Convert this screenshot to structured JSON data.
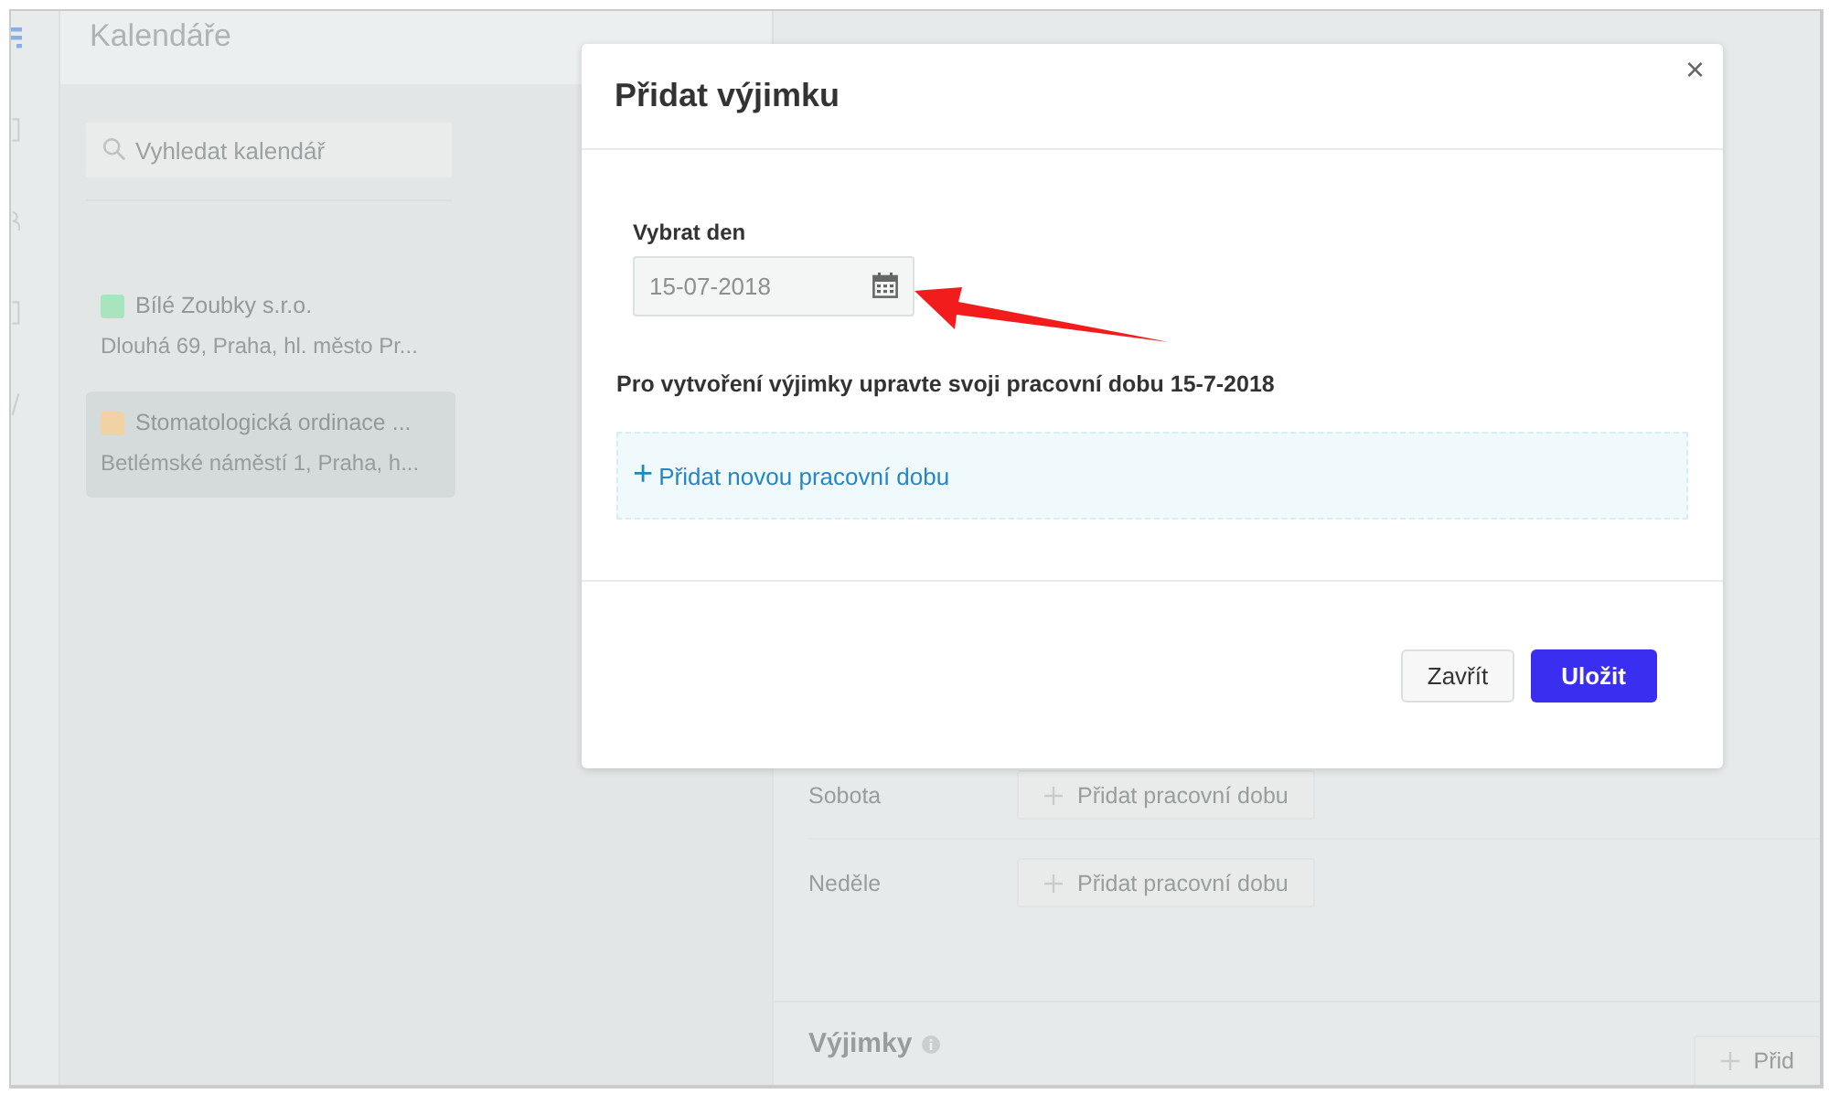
{
  "sidebar": {
    "title": "Kalendáře",
    "search": {
      "placeholder": "Vyhledat kalendář"
    },
    "calendars": [
      {
        "name": "Bílé Zoubky s.r.o.",
        "address": "Dlouhá 69, Praha, hl. město Pr...",
        "color": "#9ee6b8",
        "selected": false
      },
      {
        "name": "Stomatologická ordinace ...",
        "address": "Betlémské náměstí 1, Praha, h...",
        "color": "#f2cf98",
        "selected": true
      }
    ]
  },
  "schedule": {
    "days": [
      {
        "name": "Sobota",
        "button": "Přidat pracovní dobu"
      },
      {
        "name": "Neděle",
        "button": "Přidat pracovní dobu"
      }
    ],
    "exceptions": {
      "title": "Výjimky",
      "button": "Přid"
    }
  },
  "modal": {
    "title": "Přidat výjimku",
    "close": "×",
    "date_label": "Vybrat den",
    "date_value": "15-07-2018",
    "instruction": "Pro vytvoření výjimky upravte svoji pracovní dobu 15-7-2018",
    "add_hours": {
      "icon": "+",
      "label": "Přidat novou pracovní dobu"
    },
    "buttons": [
      {
        "kind": "secondary",
        "label": "Zavřít"
      },
      {
        "kind": "primary",
        "label": "Uložit"
      }
    ]
  }
}
